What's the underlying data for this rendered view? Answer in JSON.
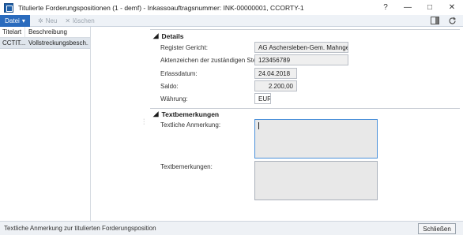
{
  "window": {
    "title": "Titulierte Forderungspositionen (1 - demf) - Inkassoauftragsnummer: INK-00000001, CCORTY-1",
    "controls": {
      "help": "?",
      "minimize": "—",
      "maximize": "□",
      "close": "✕"
    }
  },
  "toolbar": {
    "datei_label": "Datei",
    "neu_label": "Neu",
    "loeschen_label": "löschen"
  },
  "grid": {
    "columns": [
      "Titelart",
      "Beschreibung"
    ],
    "rows": [
      {
        "titelart": "CCTIT...",
        "beschreibung": "Vollstreckungsbesch..."
      }
    ]
  },
  "details": {
    "heading": "Details",
    "fields": [
      {
        "label": "Register Gericht:",
        "value": "AG Aschersleben-Gem. Mahngeric"
      },
      {
        "label": "Aktenzeichen der zuständigen Stelle:",
        "value": "123456789"
      },
      {
        "label": "Erlassdatum:",
        "value": "24.04.2018"
      },
      {
        "label": "Saldo:",
        "value": "2.200,00"
      },
      {
        "label": "Währung:",
        "value": "EUR"
      }
    ]
  },
  "textbemerkungen": {
    "heading": "Textbemerkungen",
    "anmerkung_label": "Textliche Anmerkung:",
    "bemerkungen_label": "Textbemerkungen:"
  },
  "status": {
    "text": "Textliche Anmerkung zur titulierten Forderungsposition",
    "close_label": "Schließen"
  }
}
